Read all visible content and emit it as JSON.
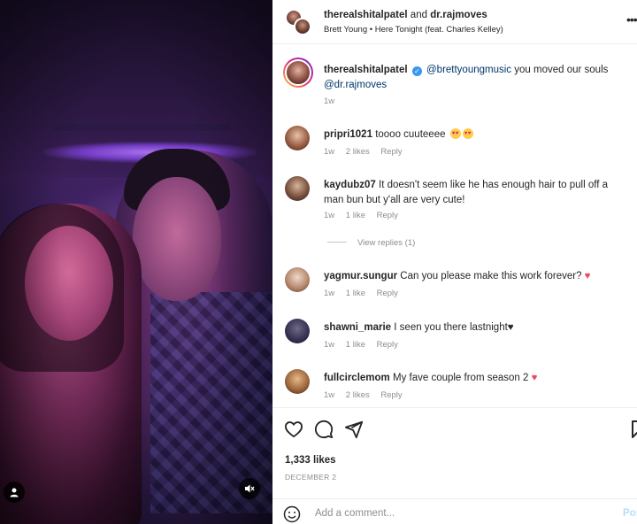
{
  "header": {
    "user1": "therealshitalpatel",
    "and_text": "and",
    "user2": "dr.rajmoves",
    "song": "Brett Young • Here Tonight (feat. Charles Kelley)",
    "more_icon": "more-horizontal-icon"
  },
  "caption": {
    "username": "therealshitalpatel",
    "mention1": "@brettyoungmusic",
    "text": "you moved our souls",
    "mention2": "@dr.rajmoves",
    "time": "1w"
  },
  "comments": [
    {
      "username": "pripri1021",
      "text": "toooo cuuteeee",
      "time": "1w",
      "likes": "2 likes",
      "reply": "Reply",
      "emoji": "heart-eyes-emoji x2"
    },
    {
      "username": "kaydubz07",
      "text": "It doesn't seem like he has enough hair to pull off a man bun but y'all are very cute!",
      "time": "1w",
      "likes": "1 like",
      "reply": "Reply"
    },
    {
      "username": "yagmur.sungur",
      "text": "Can you please make this work forever?",
      "time": "1w",
      "likes": "1 like",
      "reply": "Reply",
      "emoji": "red-heart-emoji"
    },
    {
      "username": "shawni_marie",
      "text": "I seen you there lastnight",
      "time": "1w",
      "likes": "1 like",
      "reply": "Reply",
      "emoji": "black-heart-emoji"
    },
    {
      "username": "fullcirclemom",
      "text": "My fave couple from season 2",
      "time": "1w",
      "likes": "2 likes",
      "reply": "Reply",
      "emoji": "red-heart-emoji"
    }
  ],
  "view_replies": "View replies (1)",
  "actions": {
    "like_icon": "heart-outline-icon",
    "comment_icon": "comment-bubble-icon",
    "share_icon": "paper-plane-icon",
    "save_icon": "bookmark-icon"
  },
  "likes_count": "1,333 likes",
  "date": "DECEMBER 2",
  "add_comment": {
    "placeholder": "Add a comment...",
    "post_label": "Post"
  },
  "colors": {
    "verified": "#3897f0",
    "heart": "#ed4956",
    "muted": "#8e8e8e",
    "post_disabled": "#b2dffc"
  }
}
